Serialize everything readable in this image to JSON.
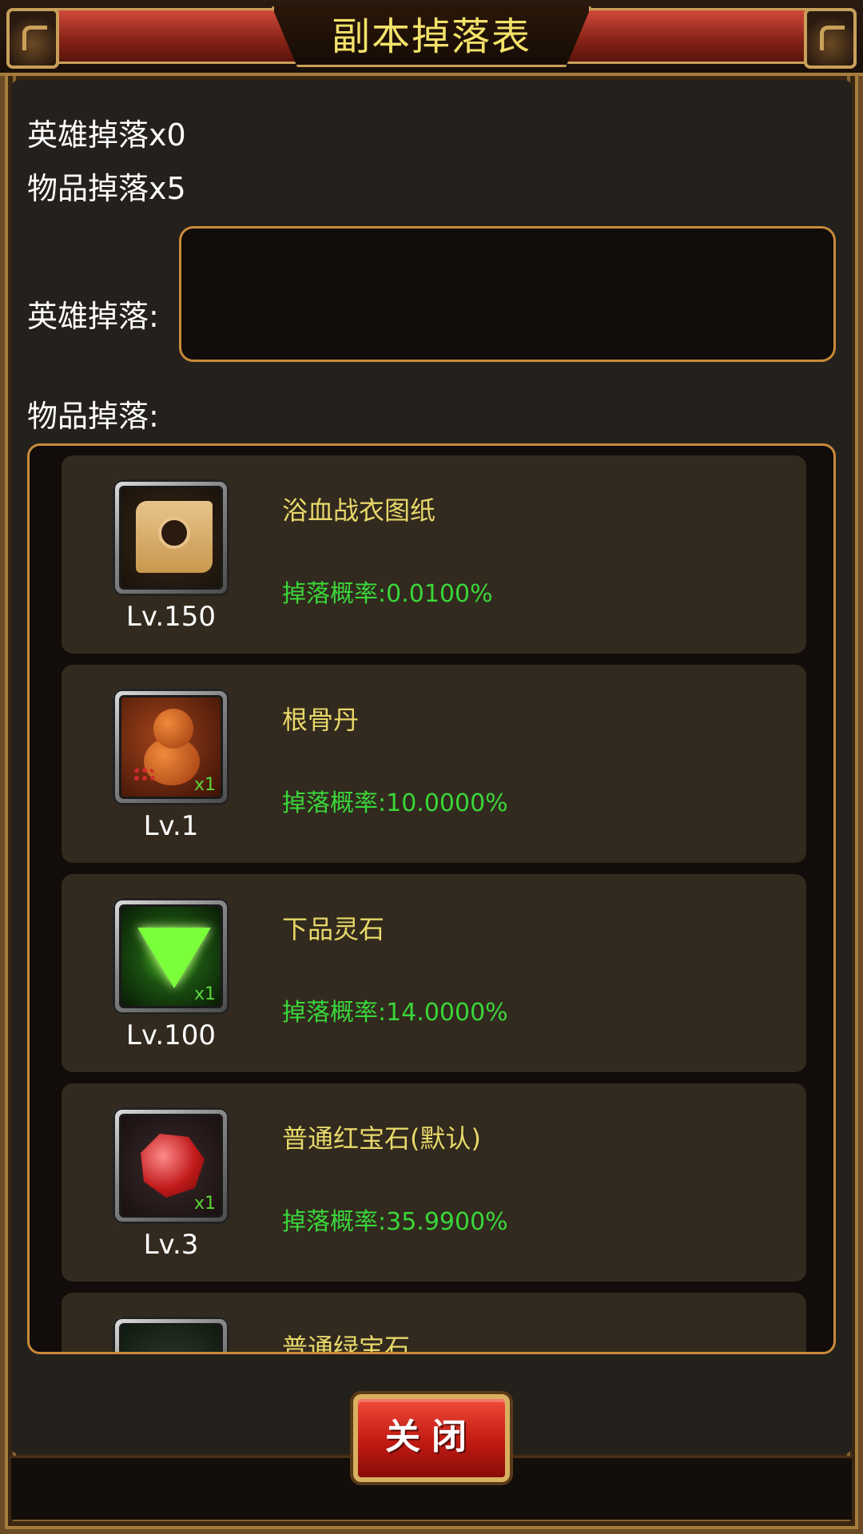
{
  "header": {
    "title": "副本掉落表"
  },
  "stats": {
    "hero_drop_count": "英雄掉落x0",
    "item_drop_count": "物品掉落x5"
  },
  "labels": {
    "hero_drop": "英雄掉落:",
    "item_drop": "物品掉落:"
  },
  "items": [
    {
      "name": "浴血战衣图纸",
      "rate": "掉落概率:0.0100%",
      "level": "Lv.150",
      "qty": "",
      "icon": "scroll-icon"
    },
    {
      "name": "根骨丹",
      "rate": "掉落概率:10.0000%",
      "level": "Lv.1",
      "qty": "x1",
      "icon": "gourd-pill-icon"
    },
    {
      "name": "下品灵石",
      "rate": "掉落概率:14.0000%",
      "level": "Lv.100",
      "qty": "x1",
      "icon": "green-spirit-stone-icon"
    },
    {
      "name": "普通红宝石(默认)",
      "rate": "掉落概率:35.9900%",
      "level": "Lv.3",
      "qty": "x1",
      "icon": "red-ruby-icon"
    },
    {
      "name": "普通绿宝石",
      "rate": "",
      "level": "",
      "qty": "",
      "icon": "green-gem-icon"
    }
  ],
  "buttons": {
    "close": "关闭"
  },
  "colors": {
    "title": "#f2e26a",
    "item_name": "#e8d86a",
    "drop_rate": "#3ad63a",
    "border_accent": "#c98a3a",
    "close_button": "#c01a12"
  }
}
